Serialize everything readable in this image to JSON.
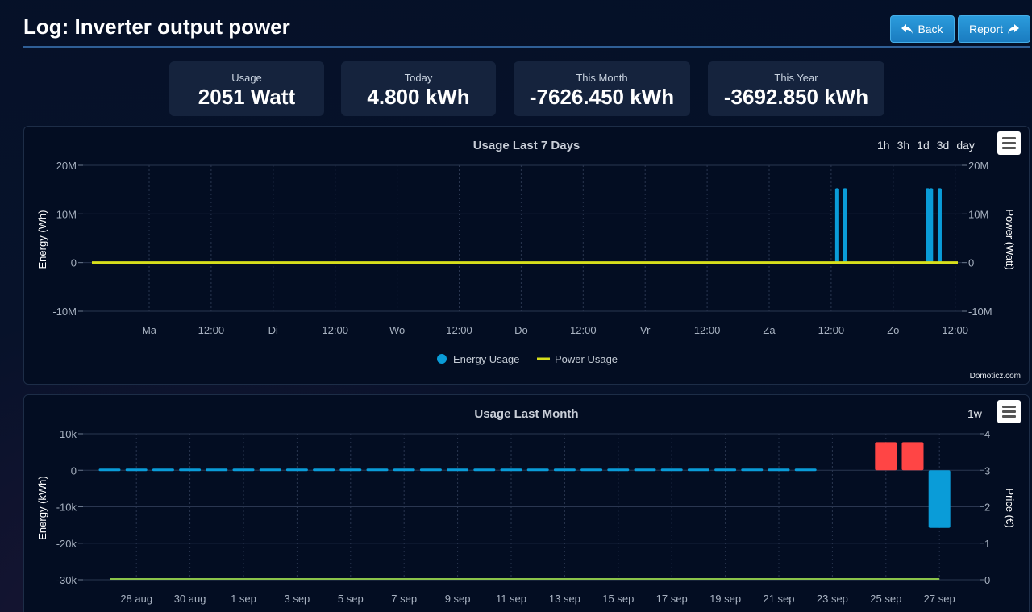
{
  "header": {
    "title": "Log: Inverter output power",
    "back_label": "Back",
    "report_label": "Report"
  },
  "stats": [
    {
      "label": "Usage",
      "value": "2051 Watt"
    },
    {
      "label": "Today",
      "value": "4.800 kWh"
    },
    {
      "label": "This Month",
      "value": "-7626.450 kWh"
    },
    {
      "label": "This Year",
      "value": "-3692.850 kWh"
    }
  ],
  "week_chart": {
    "title": "Usage Last 7 Days",
    "ranges": [
      "1h",
      "3h",
      "1d",
      "3d",
      "day"
    ],
    "credit": "Domoticz.com",
    "legend": [
      "Energy Usage",
      "Power Usage"
    ]
  },
  "month_chart": {
    "title": "Usage Last Month",
    "ranges": [
      "1w"
    ]
  },
  "colors": {
    "energy": "#0a9cd8",
    "power": "#d7de1c",
    "negative": "#ff4545",
    "price": "#8bc34a"
  },
  "chart_data": [
    {
      "type": "bar",
      "title": "Usage Last 7 Days",
      "x_tick_labels": [
        "Ma",
        "12:00",
        "Di",
        "12:00",
        "Wo",
        "12:00",
        "Do",
        "12:00",
        "Vr",
        "12:00",
        "Za",
        "12:00",
        "Zo",
        "12:00"
      ],
      "ylabel": "Energy (Wh)",
      "y2label": "Power (Watt)",
      "y_ticks": [
        "20M",
        "10M",
        "0",
        "-10M"
      ],
      "y2_ticks": [
        "20M",
        "10M",
        "0",
        "-10M"
      ],
      "ylim": [
        -10000000,
        20000000
      ],
      "series": [
        {
          "name": "Energy Usage",
          "type": "bar",
          "points": [
            {
              "x": "Za 13:10",
              "y": 15300000
            },
            {
              "x": "Za 14:40",
              "y": 15300000
            },
            {
              "x": "Zo 06:40",
              "y": 15300000
            },
            {
              "x": "Zo 07:20",
              "y": 15300000
            },
            {
              "x": "Zo 09:00",
              "y": 15300000
            }
          ]
        },
        {
          "name": "Power Usage",
          "type": "line",
          "values_note": "near 0 throughout",
          "y": 0
        }
      ]
    },
    {
      "type": "bar",
      "title": "Usage Last Month",
      "x_tick_labels": [
        "28 aug",
        "30 aug",
        "1 sep",
        "3 sep",
        "5 sep",
        "7 sep",
        "9 sep",
        "11 sep",
        "13 sep",
        "15 sep",
        "17 sep",
        "19 sep",
        "21 sep",
        "23 sep",
        "25 sep",
        "27 sep"
      ],
      "ylabel": "Energy (kWh)",
      "y2label": "Price (€)",
      "y_ticks": [
        "10k",
        "0",
        "-10k",
        "-20k",
        "-30k"
      ],
      "y2_ticks": [
        "4",
        "3",
        "2",
        "1",
        "0"
      ],
      "ylim": [
        -30000,
        10000
      ],
      "y2lim": [
        0,
        4
      ],
      "energy_bars": [
        {
          "day": "27 aug",
          "value": 0
        },
        {
          "day": "28 aug",
          "value": 0
        },
        {
          "day": "29 aug",
          "value": 0
        },
        {
          "day": "30 aug",
          "value": 0
        },
        {
          "day": "31 aug",
          "value": 0
        },
        {
          "day": "1 sep",
          "value": 0
        },
        {
          "day": "2 sep",
          "value": 0
        },
        {
          "day": "3 sep",
          "value": 0
        },
        {
          "day": "4 sep",
          "value": 0
        },
        {
          "day": "5 sep",
          "value": 0
        },
        {
          "day": "6 sep",
          "value": 0
        },
        {
          "day": "7 sep",
          "value": 0
        },
        {
          "day": "8 sep",
          "value": 0
        },
        {
          "day": "9 sep",
          "value": 0
        },
        {
          "day": "10 sep",
          "value": 0
        },
        {
          "day": "11 sep",
          "value": 0
        },
        {
          "day": "12 sep",
          "value": 0
        },
        {
          "day": "13 sep",
          "value": 0
        },
        {
          "day": "14 sep",
          "value": 0
        },
        {
          "day": "15 sep",
          "value": 0
        },
        {
          "day": "16 sep",
          "value": 0
        },
        {
          "day": "17 sep",
          "value": 0
        },
        {
          "day": "18 sep",
          "value": 0
        },
        {
          "day": "19 sep",
          "value": 0
        },
        {
          "day": "20 sep",
          "value": 0
        },
        {
          "day": "21 sep",
          "value": 0
        },
        {
          "day": "22 sep",
          "value": 0
        },
        {
          "day": "25 sep",
          "value": 7700,
          "negative_style": true
        },
        {
          "day": "26 sep",
          "value": 7700,
          "negative_style": true
        },
        {
          "day": "27 sep",
          "value": -15800
        }
      ],
      "price_line": {
        "value": 0,
        "from": "27 aug",
        "to": "27 sep"
      }
    }
  ]
}
